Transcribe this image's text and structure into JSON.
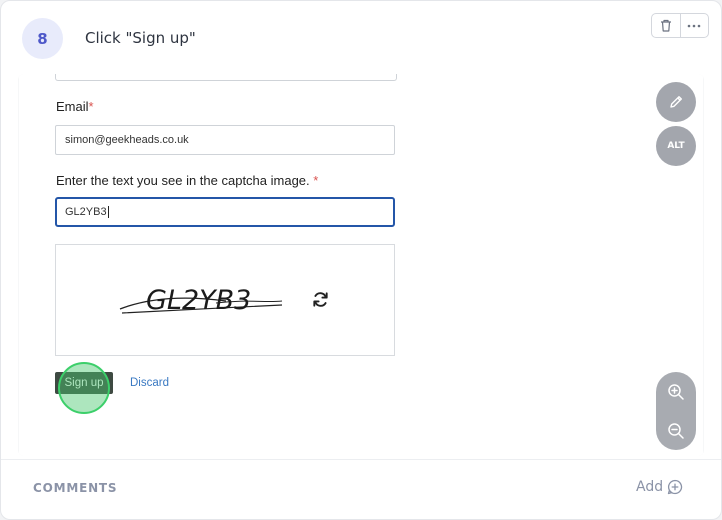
{
  "step": {
    "number": "8",
    "title": "Click \"Sign up\""
  },
  "toolbar": {
    "delete_icon": "trash-icon",
    "more_icon": "more-horizontal-icon"
  },
  "screenshot": {
    "email_label": "Email",
    "required_mark": "*",
    "email_value": "simon@geekheads.co.uk",
    "captcha_label": "Enter the text you see in the captcha image.",
    "captcha_value": "GL2YB3",
    "captcha_image_text": "GL2YB3",
    "signup_label": "Sign up",
    "discard_label": "Discard"
  },
  "side_controls": {
    "edit_icon": "pencil-icon",
    "alt_label": "ALT",
    "zoom_in_icon": "zoom-in-icon",
    "zoom_out_icon": "zoom-out-icon"
  },
  "comments": {
    "label": "COMMENTS",
    "add_label": "Add"
  },
  "colors": {
    "accent": "#4e58c9",
    "click_highlight": "#3ccf6a",
    "focus_border": "#2456a8",
    "link": "#3a79c2"
  }
}
